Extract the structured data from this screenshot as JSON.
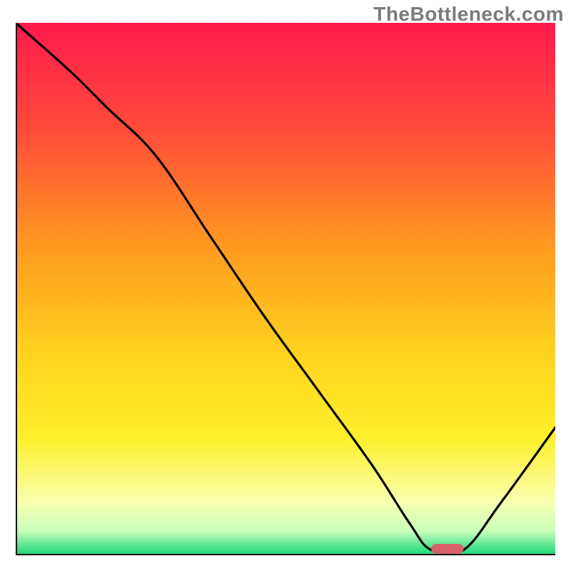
{
  "watermark": "TheBottleneck.com",
  "chart_data": {
    "type": "line",
    "title": "",
    "xlabel": "",
    "ylabel": "",
    "xlim": [
      0,
      100
    ],
    "ylim": [
      0,
      100
    ],
    "grid": false,
    "legend": false,
    "background": {
      "type": "vertical-gradient",
      "stops": [
        {
          "offset": 0.0,
          "color": "#ff1a4b"
        },
        {
          "offset": 0.2,
          "color": "#ff4b3a"
        },
        {
          "offset": 0.42,
          "color": "#ff9a1f"
        },
        {
          "offset": 0.62,
          "color": "#ffd21f"
        },
        {
          "offset": 0.78,
          "color": "#fff02a"
        },
        {
          "offset": 0.9,
          "color": "#f8ffb0"
        },
        {
          "offset": 0.955,
          "color": "#c9ffba"
        },
        {
          "offset": 0.985,
          "color": "#4be38a"
        },
        {
          "offset": 1.0,
          "color": "#1fd67a"
        }
      ]
    },
    "notes": "Axes are unlabeled; values are normalized 0–100 on both axes based on the plotting frame. Curve is a single anonymous black series. A small rounded red-pink marker sits on the x-axis near the curve minimum (approximately x≈77–83).",
    "series": [
      {
        "name": "curve",
        "color": "#000000",
        "x": [
          0,
          10,
          17,
          26,
          36,
          46,
          56,
          66,
          73,
          77,
          83,
          90,
          100
        ],
        "y": [
          100,
          91,
          84,
          75,
          60,
          45,
          31,
          17,
          6,
          1,
          1,
          10,
          24
        ]
      }
    ],
    "marker": {
      "name": "min-marker",
      "shape": "rounded-rect",
      "color": "#d9606a",
      "x_range": [
        77,
        83
      ],
      "y": 1,
      "approx_pixel_size": {
        "w": 48,
        "h": 14,
        "rx": 7
      }
    },
    "axes": {
      "color": "#000000",
      "lineWidth": 4
    }
  }
}
